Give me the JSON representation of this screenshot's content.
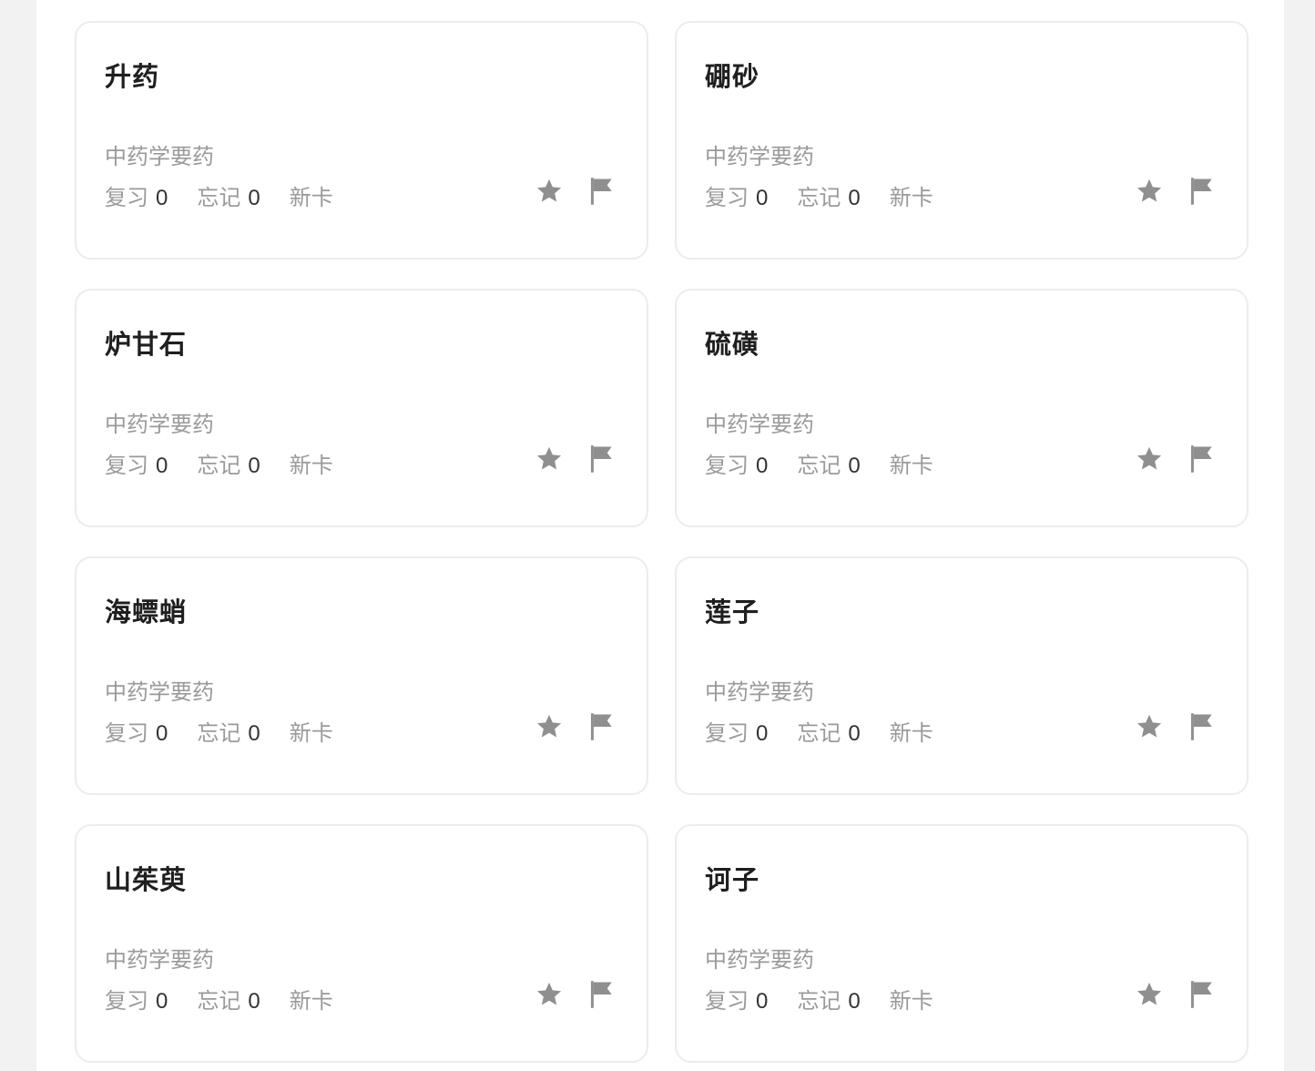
{
  "cards": [
    {
      "title": "升药",
      "category": "中药学要药",
      "review_label": "复习",
      "review_count": "0",
      "forget_label": "忘记",
      "forget_count": "0",
      "status": "新卡"
    },
    {
      "title": "硼砂",
      "category": "中药学要药",
      "review_label": "复习",
      "review_count": "0",
      "forget_label": "忘记",
      "forget_count": "0",
      "status": "新卡"
    },
    {
      "title": "炉甘石",
      "category": "中药学要药",
      "review_label": "复习",
      "review_count": "0",
      "forget_label": "忘记",
      "forget_count": "0",
      "status": "新卡"
    },
    {
      "title": "硫磺",
      "category": "中药学要药",
      "review_label": "复习",
      "review_count": "0",
      "forget_label": "忘记",
      "forget_count": "0",
      "status": "新卡"
    },
    {
      "title": "海螵蛸",
      "category": "中药学要药",
      "review_label": "复习",
      "review_count": "0",
      "forget_label": "忘记",
      "forget_count": "0",
      "status": "新卡"
    },
    {
      "title": "莲子",
      "category": "中药学要药",
      "review_label": "复习",
      "review_count": "0",
      "forget_label": "忘记",
      "forget_count": "0",
      "status": "新卡"
    },
    {
      "title": "山茱萸",
      "category": "中药学要药",
      "review_label": "复习",
      "review_count": "0",
      "forget_label": "忘记",
      "forget_count": "0",
      "status": "新卡"
    },
    {
      "title": "诃子",
      "category": "中药学要药",
      "review_label": "复习",
      "review_count": "0",
      "forget_label": "忘记",
      "forget_count": "0",
      "status": "新卡"
    }
  ],
  "icons": {
    "star": "star-icon",
    "flag": "flag-icon"
  },
  "colors": {
    "background": "#f2f2f2",
    "card_border": "#ececec",
    "title": "#1f1f1f",
    "muted_text": "#9a9a9a",
    "icon": "#8f8f8f"
  }
}
